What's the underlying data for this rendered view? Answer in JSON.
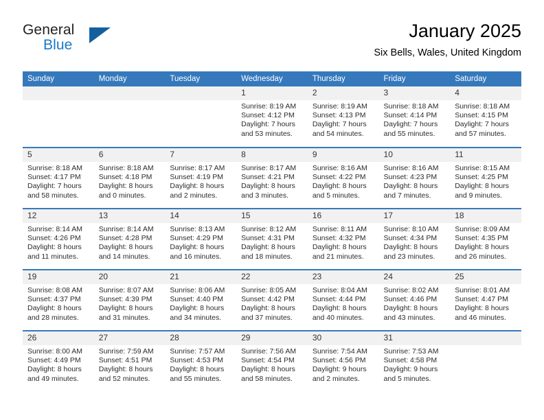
{
  "brand": {
    "name_part1": "General",
    "name_part2": "Blue",
    "logo_icon": "triangle-logo-icon"
  },
  "header": {
    "title": "January 2025",
    "subtitle": "Six Bells, Wales, United Kingdom"
  },
  "theme": {
    "accent": "#3579bc",
    "brand_blue": "#1878c8",
    "logo_triangle": "#14609f",
    "daynum_bg": "#f1f1f1",
    "text": "#2b2b2b"
  },
  "calendar": {
    "weekday_headers": [
      "Sunday",
      "Monday",
      "Tuesday",
      "Wednesday",
      "Thursday",
      "Friday",
      "Saturday"
    ],
    "weeks": [
      [
        {
          "empty": true
        },
        {
          "empty": true
        },
        {
          "empty": true
        },
        {
          "day": "1",
          "sunrise": "Sunrise: 8:19 AM",
          "sunset": "Sunset: 4:12 PM",
          "daylight": "Daylight: 7 hours and 53 minutes."
        },
        {
          "day": "2",
          "sunrise": "Sunrise: 8:19 AM",
          "sunset": "Sunset: 4:13 PM",
          "daylight": "Daylight: 7 hours and 54 minutes."
        },
        {
          "day": "3",
          "sunrise": "Sunrise: 8:18 AM",
          "sunset": "Sunset: 4:14 PM",
          "daylight": "Daylight: 7 hours and 55 minutes."
        },
        {
          "day": "4",
          "sunrise": "Sunrise: 8:18 AM",
          "sunset": "Sunset: 4:15 PM",
          "daylight": "Daylight: 7 hours and 57 minutes."
        }
      ],
      [
        {
          "day": "5",
          "sunrise": "Sunrise: 8:18 AM",
          "sunset": "Sunset: 4:17 PM",
          "daylight": "Daylight: 7 hours and 58 minutes."
        },
        {
          "day": "6",
          "sunrise": "Sunrise: 8:18 AM",
          "sunset": "Sunset: 4:18 PM",
          "daylight": "Daylight: 8 hours and 0 minutes."
        },
        {
          "day": "7",
          "sunrise": "Sunrise: 8:17 AM",
          "sunset": "Sunset: 4:19 PM",
          "daylight": "Daylight: 8 hours and 2 minutes."
        },
        {
          "day": "8",
          "sunrise": "Sunrise: 8:17 AM",
          "sunset": "Sunset: 4:21 PM",
          "daylight": "Daylight: 8 hours and 3 minutes."
        },
        {
          "day": "9",
          "sunrise": "Sunrise: 8:16 AM",
          "sunset": "Sunset: 4:22 PM",
          "daylight": "Daylight: 8 hours and 5 minutes."
        },
        {
          "day": "10",
          "sunrise": "Sunrise: 8:16 AM",
          "sunset": "Sunset: 4:23 PM",
          "daylight": "Daylight: 8 hours and 7 minutes."
        },
        {
          "day": "11",
          "sunrise": "Sunrise: 8:15 AM",
          "sunset": "Sunset: 4:25 PM",
          "daylight": "Daylight: 8 hours and 9 minutes."
        }
      ],
      [
        {
          "day": "12",
          "sunrise": "Sunrise: 8:14 AM",
          "sunset": "Sunset: 4:26 PM",
          "daylight": "Daylight: 8 hours and 11 minutes."
        },
        {
          "day": "13",
          "sunrise": "Sunrise: 8:14 AM",
          "sunset": "Sunset: 4:28 PM",
          "daylight": "Daylight: 8 hours and 14 minutes."
        },
        {
          "day": "14",
          "sunrise": "Sunrise: 8:13 AM",
          "sunset": "Sunset: 4:29 PM",
          "daylight": "Daylight: 8 hours and 16 minutes."
        },
        {
          "day": "15",
          "sunrise": "Sunrise: 8:12 AM",
          "sunset": "Sunset: 4:31 PM",
          "daylight": "Daylight: 8 hours and 18 minutes."
        },
        {
          "day": "16",
          "sunrise": "Sunrise: 8:11 AM",
          "sunset": "Sunset: 4:32 PM",
          "daylight": "Daylight: 8 hours and 21 minutes."
        },
        {
          "day": "17",
          "sunrise": "Sunrise: 8:10 AM",
          "sunset": "Sunset: 4:34 PM",
          "daylight": "Daylight: 8 hours and 23 minutes."
        },
        {
          "day": "18",
          "sunrise": "Sunrise: 8:09 AM",
          "sunset": "Sunset: 4:35 PM",
          "daylight": "Daylight: 8 hours and 26 minutes."
        }
      ],
      [
        {
          "day": "19",
          "sunrise": "Sunrise: 8:08 AM",
          "sunset": "Sunset: 4:37 PM",
          "daylight": "Daylight: 8 hours and 28 minutes."
        },
        {
          "day": "20",
          "sunrise": "Sunrise: 8:07 AM",
          "sunset": "Sunset: 4:39 PM",
          "daylight": "Daylight: 8 hours and 31 minutes."
        },
        {
          "day": "21",
          "sunrise": "Sunrise: 8:06 AM",
          "sunset": "Sunset: 4:40 PM",
          "daylight": "Daylight: 8 hours and 34 minutes."
        },
        {
          "day": "22",
          "sunrise": "Sunrise: 8:05 AM",
          "sunset": "Sunset: 4:42 PM",
          "daylight": "Daylight: 8 hours and 37 minutes."
        },
        {
          "day": "23",
          "sunrise": "Sunrise: 8:04 AM",
          "sunset": "Sunset: 4:44 PM",
          "daylight": "Daylight: 8 hours and 40 minutes."
        },
        {
          "day": "24",
          "sunrise": "Sunrise: 8:02 AM",
          "sunset": "Sunset: 4:46 PM",
          "daylight": "Daylight: 8 hours and 43 minutes."
        },
        {
          "day": "25",
          "sunrise": "Sunrise: 8:01 AM",
          "sunset": "Sunset: 4:47 PM",
          "daylight": "Daylight: 8 hours and 46 minutes."
        }
      ],
      [
        {
          "day": "26",
          "sunrise": "Sunrise: 8:00 AM",
          "sunset": "Sunset: 4:49 PM",
          "daylight": "Daylight: 8 hours and 49 minutes."
        },
        {
          "day": "27",
          "sunrise": "Sunrise: 7:59 AM",
          "sunset": "Sunset: 4:51 PM",
          "daylight": "Daylight: 8 hours and 52 minutes."
        },
        {
          "day": "28",
          "sunrise": "Sunrise: 7:57 AM",
          "sunset": "Sunset: 4:53 PM",
          "daylight": "Daylight: 8 hours and 55 minutes."
        },
        {
          "day": "29",
          "sunrise": "Sunrise: 7:56 AM",
          "sunset": "Sunset: 4:54 PM",
          "daylight": "Daylight: 8 hours and 58 minutes."
        },
        {
          "day": "30",
          "sunrise": "Sunrise: 7:54 AM",
          "sunset": "Sunset: 4:56 PM",
          "daylight": "Daylight: 9 hours and 2 minutes."
        },
        {
          "day": "31",
          "sunrise": "Sunrise: 7:53 AM",
          "sunset": "Sunset: 4:58 PM",
          "daylight": "Daylight: 9 hours and 5 minutes."
        },
        {
          "empty": true
        }
      ]
    ]
  }
}
